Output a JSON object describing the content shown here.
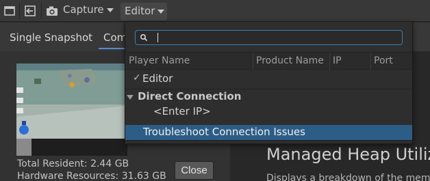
{
  "toolbar": {
    "capture_label": "Capture",
    "target_label": "Editor"
  },
  "tabs": {
    "single_snapshot": "Single Snapshot",
    "compare": "Com"
  },
  "snapshot_panel": {
    "total_resident": "Total Resident: 2.44 GB",
    "hardware_resources": "Hardware Resources: 31.63 GB",
    "close_label": "Close"
  },
  "content": {
    "heading": "Managed Heap Utiliz",
    "description": "Displays a breakdown of the mem"
  },
  "target_dropdown": {
    "search": {
      "value": "",
      "placeholder": ""
    },
    "columns": [
      "Player Name",
      "Product Name",
      "IP",
      "Port"
    ],
    "items": {
      "editor": {
        "checkmark": "✓",
        "label": "Editor"
      },
      "direct_connection": {
        "label": "Direct Connection"
      },
      "enter_ip": {
        "label": "<Enter IP>"
      },
      "troubleshoot": {
        "label": "Troubleshoot Connection Issues"
      }
    }
  },
  "colors": {
    "selection": "#2c5d87",
    "search_border": "#3d7fb5",
    "tab_accent": "#5a8ad0"
  }
}
